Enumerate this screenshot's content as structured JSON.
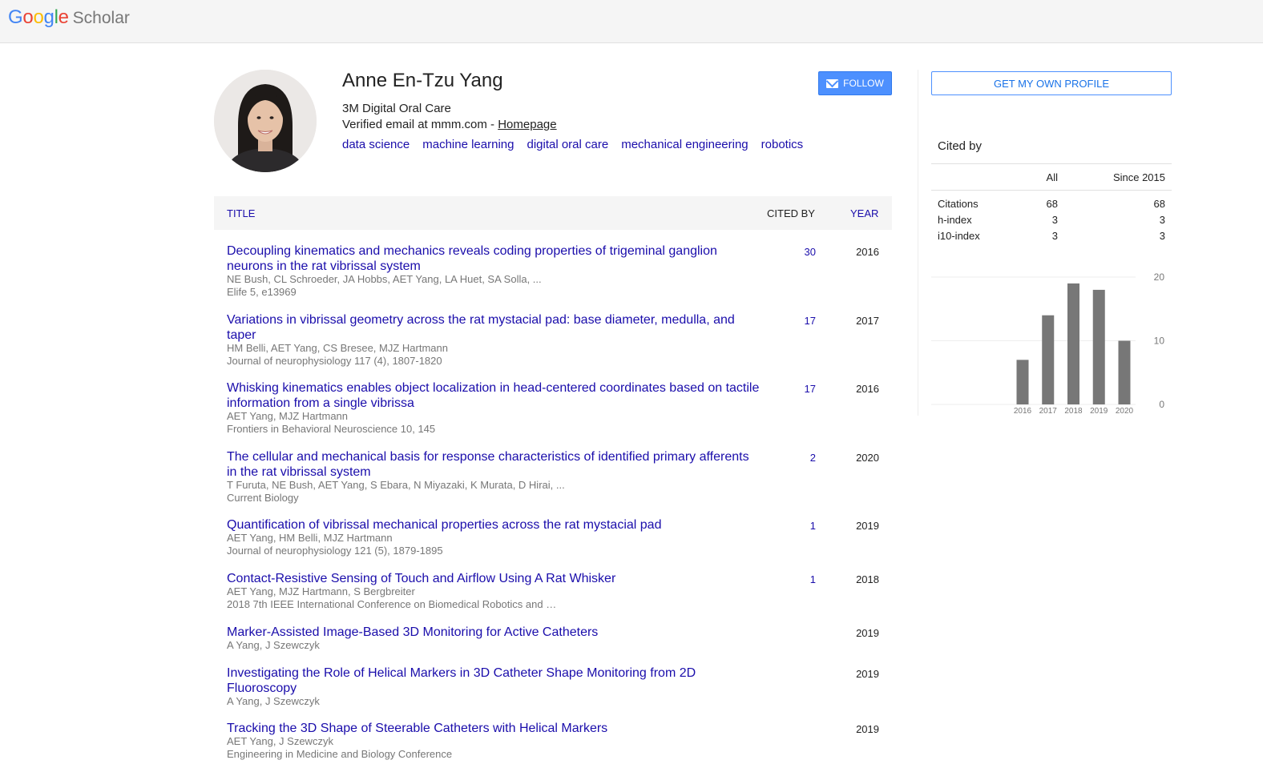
{
  "header": {
    "logo_google": [
      "G",
      "o",
      "o",
      "g",
      "l",
      "e"
    ],
    "logo_scholar": "Scholar"
  },
  "profile": {
    "name": "Anne En-Tzu Yang",
    "affiliation": "3M Digital Oral Care",
    "email_text": "Verified email at mmm.com - ",
    "homepage_link": "Homepage",
    "interests": [
      "data science",
      "machine learning",
      "digital oral care",
      "mechanical engineering",
      "robotics"
    ],
    "follow_label": "FOLLOW"
  },
  "table": {
    "headers": {
      "title": "TITLE",
      "cited_by": "CITED BY",
      "year": "YEAR"
    },
    "rows": [
      {
        "title": "Decoupling kinematics and mechanics reveals coding properties of trigeminal ganglion neurons in the rat vibrissal system",
        "authors": "NE Bush, CL Schroeder, JA Hobbs, AET Yang, LA Huet, SA Solla, ...",
        "venue": "Elife 5, e13969",
        "cites": "30",
        "year": "2016"
      },
      {
        "title": "Variations in vibrissal geometry across the rat mystacial pad: base diameter, medulla, and taper",
        "authors": "HM Belli, AET Yang, CS Bresee, MJZ Hartmann",
        "venue": "Journal of neurophysiology 117 (4), 1807-1820",
        "cites": "17",
        "year": "2017"
      },
      {
        "title": "Whisking kinematics enables object localization in head-centered coordinates based on tactile information from a single vibrissa",
        "authors": "AET Yang, MJZ Hartmann",
        "venue": "Frontiers in Behavioral Neuroscience 10, 145",
        "cites": "17",
        "year": "2016"
      },
      {
        "title": "The cellular and mechanical basis for response characteristics of identified primary afferents in the rat vibrissal system",
        "authors": "T Furuta, NE Bush, AET Yang, S Ebara, N Miyazaki, K Murata, D Hirai, ...",
        "venue": "Current Biology",
        "cites": "2",
        "year": "2020"
      },
      {
        "title": "Quantification of vibrissal mechanical properties across the rat mystacial pad",
        "authors": "AET Yang, HM Belli, MJZ Hartmann",
        "venue": "Journal of neurophysiology 121 (5), 1879-1895",
        "cites": "1",
        "year": "2019"
      },
      {
        "title": "Contact-Resistive Sensing of Touch and Airflow Using A Rat Whisker",
        "authors": "AET Yang, MJZ Hartmann, S Bergbreiter",
        "venue": "2018 7th IEEE International Conference on Biomedical Robotics and …",
        "cites": "1",
        "year": "2018"
      },
      {
        "title": "Marker-Assisted Image-Based 3D Monitoring for Active Catheters",
        "authors": "A Yang, J Szewczyk",
        "venue": "",
        "cites": "",
        "year": "2019"
      },
      {
        "title": "Investigating the Role of Helical Markers in 3D Catheter Shape Monitoring from 2D Fluoroscopy",
        "authors": "A Yang, J Szewczyk",
        "venue": "",
        "cites": "",
        "year": "2019"
      },
      {
        "title": "Tracking the 3D Shape of Steerable Catheters with Helical Markers",
        "authors": "AET Yang, J Szewczyk",
        "venue": "Engineering in Medicine and Biology Conference",
        "cites": "",
        "year": "2019"
      }
    ]
  },
  "sidebar": {
    "own_profile_label": "GET MY OWN PROFILE",
    "cited_by_title": "Cited by",
    "col_all": "All",
    "col_since": "Since 2015",
    "stats": [
      {
        "label": "Citations",
        "all": "68",
        "since": "68"
      },
      {
        "label": "h-index",
        "all": "3",
        "since": "3"
      },
      {
        "label": "i10-index",
        "all": "3",
        "since": "3"
      }
    ]
  },
  "chart_data": {
    "type": "bar",
    "categories": [
      "2016",
      "2017",
      "2018",
      "2019",
      "2020"
    ],
    "values": [
      7,
      14,
      19,
      18,
      10
    ],
    "ylim": [
      0,
      20
    ],
    "yticks": [
      0,
      10,
      20
    ],
    "grid": true,
    "bar_color": "#777777"
  },
  "colors": {
    "link": "#1a0dab",
    "accent": "#4d90fe",
    "header_bg": "#f5f5f5"
  }
}
